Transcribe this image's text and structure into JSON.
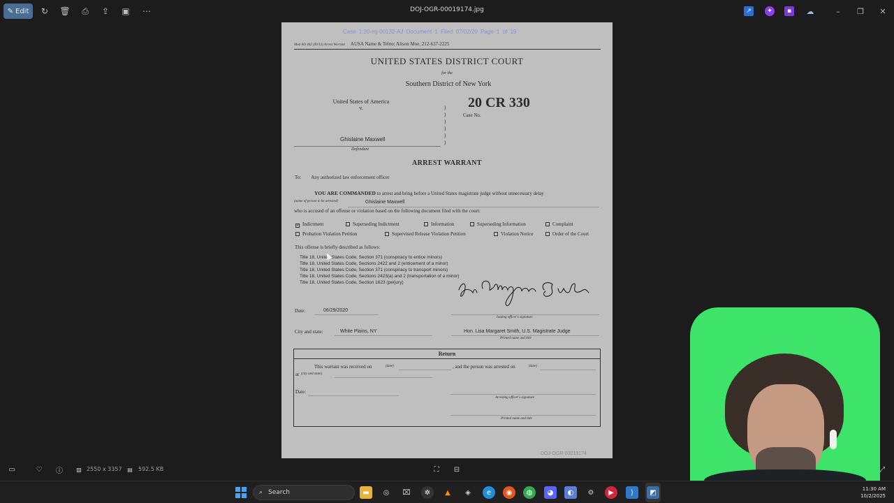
{
  "topbar": {
    "edit_label": "Edit",
    "file_title": "DOJ-OGR-00019174.jpg",
    "icons": [
      "rotate-icon",
      "delete-icon",
      "print-icon",
      "share-icon",
      "slideshow-icon",
      "more-icon"
    ]
  },
  "document": {
    "header_stamp": "Case 1:20-mj-00132-AJ   Document 1   Filed 07/02/20   Page 1 of 19",
    "form_code": "Mod AO 442 (09/13) Arrest Warrant",
    "ausa": "AUSA Name & Telno: Alison Moe, 212-637-2225",
    "court": "UNITED STATES DISTRICT COURT",
    "for_the": "for the",
    "district": "Southern District of New York",
    "plaintiff": "United States of America",
    "versus": "v.",
    "case_number": "20 CR 330",
    "case_no_label": "Case No.",
    "defendant_name": "Ghislaine Maxwell",
    "defendant_label": "Defendant",
    "title": "ARREST WARRANT",
    "to_label": "To:",
    "to_text": "Any authorized law enforcement officer",
    "commanded_bold": "YOU ARE COMMANDED",
    "commanded_text": " to arrest and bring before a United States magistrate judge without unnecessary delay",
    "person_label": "(name of person to be arrested)",
    "person_name": "Ghislaine Maxwell",
    "accused_text": "who is accused of an offense or violation based on the following document filed with the court:",
    "checkboxes": [
      {
        "label": "Indictment",
        "checked": true
      },
      {
        "label": "Superseding Indictment",
        "checked": false
      },
      {
        "label": "Information",
        "checked": false
      },
      {
        "label": "Superseding Information",
        "checked": false
      },
      {
        "label": "Complaint",
        "checked": false
      },
      {
        "label": "Probation Violation Petition",
        "checked": false
      },
      {
        "label": "Supervised Release Violation Petition",
        "checked": false
      },
      {
        "label": "Violation Notice",
        "checked": false
      },
      {
        "label": "Order of the Court",
        "checked": false
      }
    ],
    "briefly": "This offense is briefly described as follows:",
    "charges": [
      "Title 18, United States Code, Section 371 (conspiracy to entice minors)",
      "Title 18, United States Code, Sections 2422 and 2 (enticement of a minor)",
      "Title 18, United States Code, Section 371 (conspiracy to transport minors)",
      "Title 18, United States Code, Sections 2423(a) and 2 (transportation of a minor)",
      "Title 18, United States Code, Section 1623 (perjury)"
    ],
    "date_label": "Date:",
    "date_value": "06/29/2020",
    "issuing_label": "Issuing officer's signature",
    "city_label": "City and state:",
    "city_value": "White Plains, NY",
    "judge": "Hon. Lisa Margaret Smith, U.S. Magistrate Judge",
    "printed_label": "Printed name and title",
    "return": {
      "heading": "Return",
      "received_text": "This warrant was received on",
      "date_small": "(date)",
      "arrested_text": ", and the person was arrested on",
      "at_label": "at",
      "city_small": "(city and state)",
      "date_label": "Date:",
      "arresting_label": "Arresting officer's signature",
      "printed_label": "Printed name and title"
    },
    "footer_id": "DOJ-OGR-00019174"
  },
  "statusbar": {
    "dimensions": "2550 x 3357",
    "filesize": "592.5 KB"
  },
  "taskbar": {
    "search_label": "Search",
    "time": "11:30 AM",
    "date": "10/2/2025"
  },
  "colors": {
    "edit_button": "#4a6d93",
    "page_bg": "#bfbfbf",
    "stamp_text": "#8d8fd0",
    "webcam_bg": "#3ee36a"
  }
}
